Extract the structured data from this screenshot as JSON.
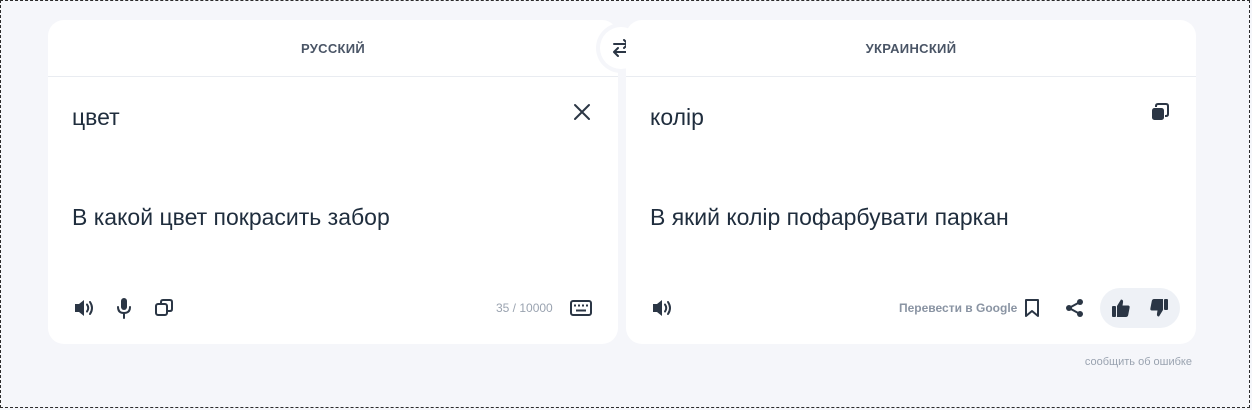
{
  "source": {
    "language": "РУССКИЙ",
    "word": "цвет",
    "sentence": "В какой цвет покрасить забор",
    "counter": "35 / 10000"
  },
  "target": {
    "language": "УКРАИНСКИЙ",
    "word": "колір",
    "sentence": "В який колір пофарбувати паркан",
    "google_link": "Перевести в Google"
  },
  "footer": {
    "report_link": "сообщить об ошибке"
  },
  "icons": {
    "swap": "swap-arrows-icon",
    "clear": "close-icon",
    "copy": "copy-icon",
    "speaker": "speaker-icon",
    "microphone": "microphone-icon",
    "keyboard": "keyboard-icon",
    "bookmark": "bookmark-icon",
    "share": "share-icon",
    "like": "thumbs-up-icon",
    "dislike": "thumbs-down-icon"
  },
  "colors": {
    "background": "#f5f6fa",
    "panel": "#ffffff",
    "text": "#1f2d3d",
    "muted": "#9aa3b0"
  }
}
